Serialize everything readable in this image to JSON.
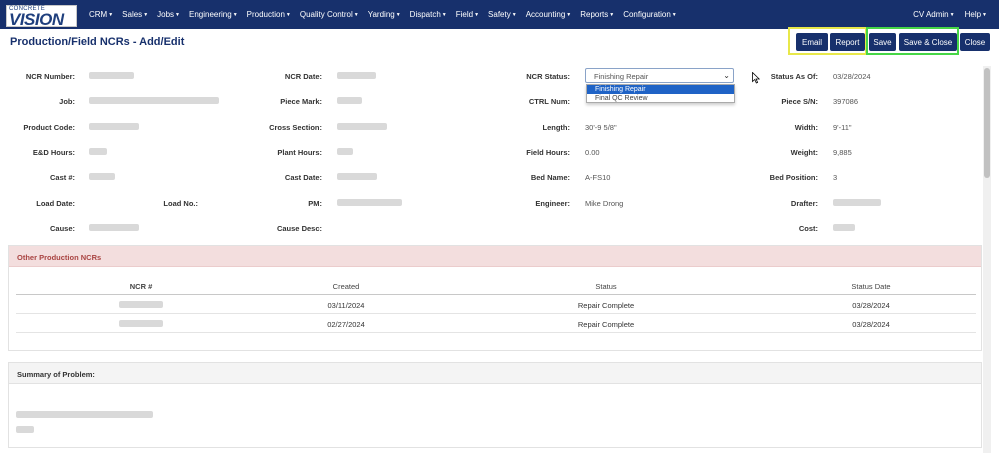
{
  "brand": {
    "top": "CONCRETE",
    "main": "VISION"
  },
  "nav": {
    "items": [
      "CRM",
      "Sales",
      "Jobs",
      "Engineering",
      "Production",
      "Quality Control",
      "Yarding",
      "Dispatch",
      "Field",
      "Safety",
      "Accounting",
      "Reports",
      "Configuration"
    ],
    "user": "CV Admin",
    "help": "Help"
  },
  "page_title": "Production/Field NCRs - Add/Edit",
  "actions": {
    "email": "Email",
    "report": "Report",
    "save": "Save",
    "save_close": "Save & Close",
    "close": "Close"
  },
  "fields": {
    "ncr_number": "NCR Number:",
    "ncr_date": "NCR Date:",
    "ncr_status": "NCR Status:",
    "status_as_of": "Status As Of:",
    "status_as_of_value": "03/28/2024",
    "job": "Job:",
    "piece_mark": "Piece Mark:",
    "ctrl_num": "CTRL Num:",
    "piece_sn": "Piece S/N:",
    "piece_sn_value": "397086",
    "product_code": "Product Code:",
    "cross_section": "Cross Section:",
    "length": "Length:",
    "length_value": "30'-9 5/8\"",
    "width": "Width:",
    "width_value": "9'-11\"",
    "ed_hours": "E&D Hours:",
    "plant_hours": "Plant Hours:",
    "field_hours": "Field Hours:",
    "field_hours_value": "0.00",
    "weight": "Weight:",
    "weight_value": "9,885",
    "cast_num": "Cast #:",
    "cast_date": "Cast Date:",
    "bed_name": "Bed Name:",
    "bed_name_value": "A-FS10",
    "bed_position": "Bed Position:",
    "bed_position_value": "3",
    "load_date": "Load Date:",
    "load_no": "Load No.:",
    "pm": "PM:",
    "engineer": "Engineer:",
    "engineer_value": "Mike Drong",
    "drafter": "Drafter:",
    "cause": "Cause:",
    "cause_desc": "Cause Desc:",
    "cost": "Cost:"
  },
  "ncr_status_select": {
    "selected": "Finishing Repair",
    "options": [
      "Finishing Repair",
      "Final QC Review"
    ]
  },
  "other_ncrs": {
    "title": "Other Production NCRs",
    "columns": [
      "NCR #",
      "Created",
      "Status",
      "Status Date"
    ],
    "rows": [
      {
        "created": "03/11/2024",
        "status": "Repair Complete",
        "status_date": "03/28/2024"
      },
      {
        "created": "02/27/2024",
        "status": "Repair Complete",
        "status_date": "03/28/2024"
      }
    ]
  },
  "summary": {
    "title": "Summary of Problem:"
  }
}
